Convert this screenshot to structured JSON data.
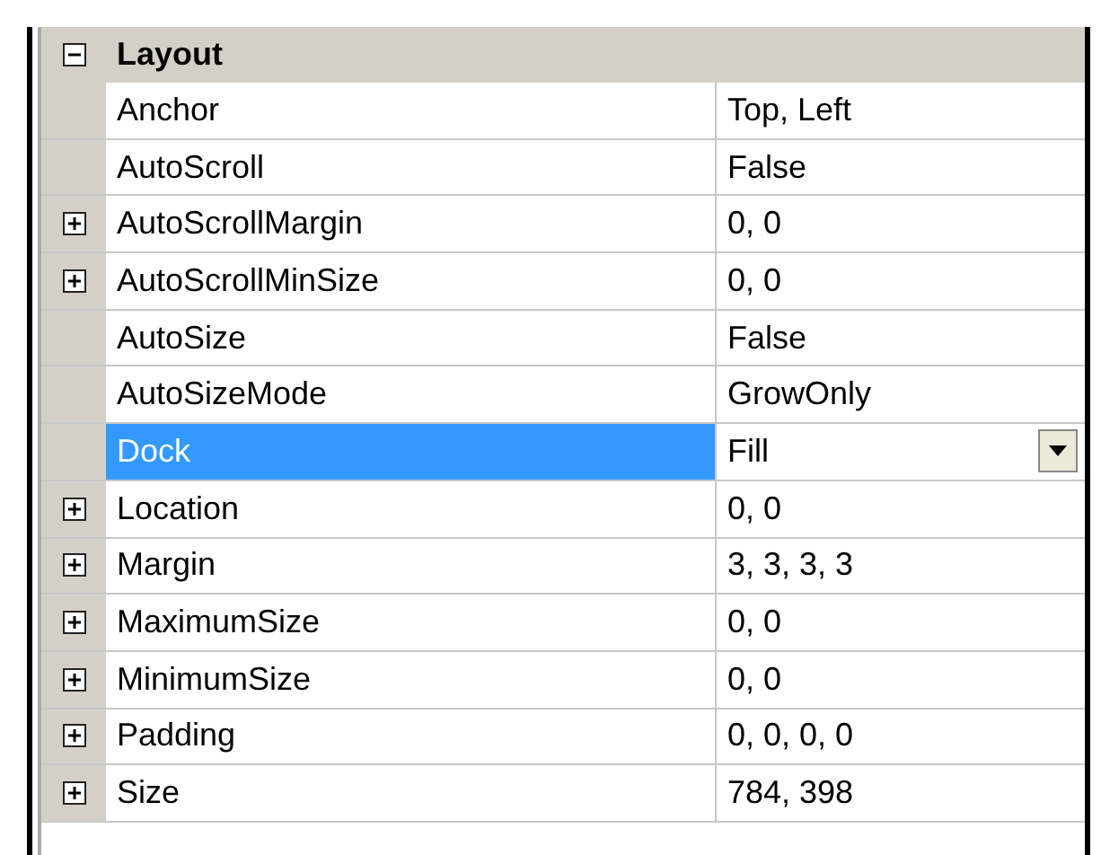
{
  "category": {
    "title": "Layout",
    "expanded": true
  },
  "properties": [
    {
      "name": "Anchor",
      "value": "Top, Left",
      "expandable": false,
      "selected": false,
      "kind": "text"
    },
    {
      "name": "AutoScroll",
      "value": "False",
      "expandable": false,
      "selected": false,
      "kind": "text"
    },
    {
      "name": "AutoScrollMargin",
      "value": "0, 0",
      "expandable": true,
      "selected": false,
      "kind": "text"
    },
    {
      "name": "AutoScrollMinSize",
      "value": "0, 0",
      "expandable": true,
      "selected": false,
      "kind": "text"
    },
    {
      "name": "AutoSize",
      "value": "False",
      "expandable": false,
      "selected": false,
      "kind": "text"
    },
    {
      "name": "AutoSizeMode",
      "value": "GrowOnly",
      "expandable": false,
      "selected": false,
      "kind": "text"
    },
    {
      "name": "Dock",
      "value": "Fill",
      "expandable": false,
      "selected": true,
      "kind": "dropdown"
    },
    {
      "name": "Location",
      "value": "0, 0",
      "expandable": true,
      "selected": false,
      "kind": "text"
    },
    {
      "name": "Margin",
      "value": "3, 3, 3, 3",
      "expandable": true,
      "selected": false,
      "kind": "text"
    },
    {
      "name": "MaximumSize",
      "value": "0, 0",
      "expandable": true,
      "selected": false,
      "kind": "text"
    },
    {
      "name": "MinimumSize",
      "value": "0, 0",
      "expandable": true,
      "selected": false,
      "kind": "text"
    },
    {
      "name": "Padding",
      "value": "0, 0, 0, 0",
      "expandable": true,
      "selected": false,
      "kind": "text"
    },
    {
      "name": "Size",
      "value": "784, 398",
      "expandable": true,
      "selected": false,
      "kind": "text"
    }
  ]
}
